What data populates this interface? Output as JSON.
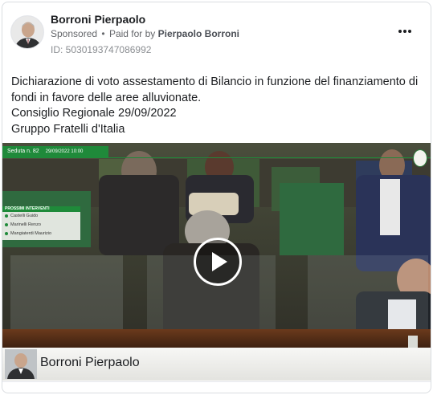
{
  "post": {
    "page_name": "Borroni Pierpaolo",
    "sponsored": "Sponsored",
    "separator": "•",
    "paid_for_label": "Paid for by",
    "payer": "Pierpaolo Borroni",
    "ad_id": "ID: 5030193747086992",
    "text_lines": [
      "Dichiarazione di voto assestamento di Bilancio in funzione del finanziamento di",
      "fondi in favore delle aree alluvionate.",
      "Consiglio Regionale 29/09/2022",
      "Gruppo Fratelli d'Italia"
    ]
  },
  "video": {
    "session_label": "Seduta n. 82",
    "session_datetime": "29/09/2022 10:00",
    "upcoming_title": "PROSSIMI INTERVENTI",
    "upcoming_speakers": [
      "Castelli Guido",
      "Marinelli Renzo",
      "Mangiaterdi Maurizio"
    ],
    "lower_third_name": "Borroni Pierpaolo"
  },
  "colors": {
    "accent_green": "#1f8a3a",
    "text_primary": "#1c1e21",
    "text_secondary": "#65676b"
  },
  "icons": {
    "more": "more-options-icon",
    "play": "play-icon"
  }
}
